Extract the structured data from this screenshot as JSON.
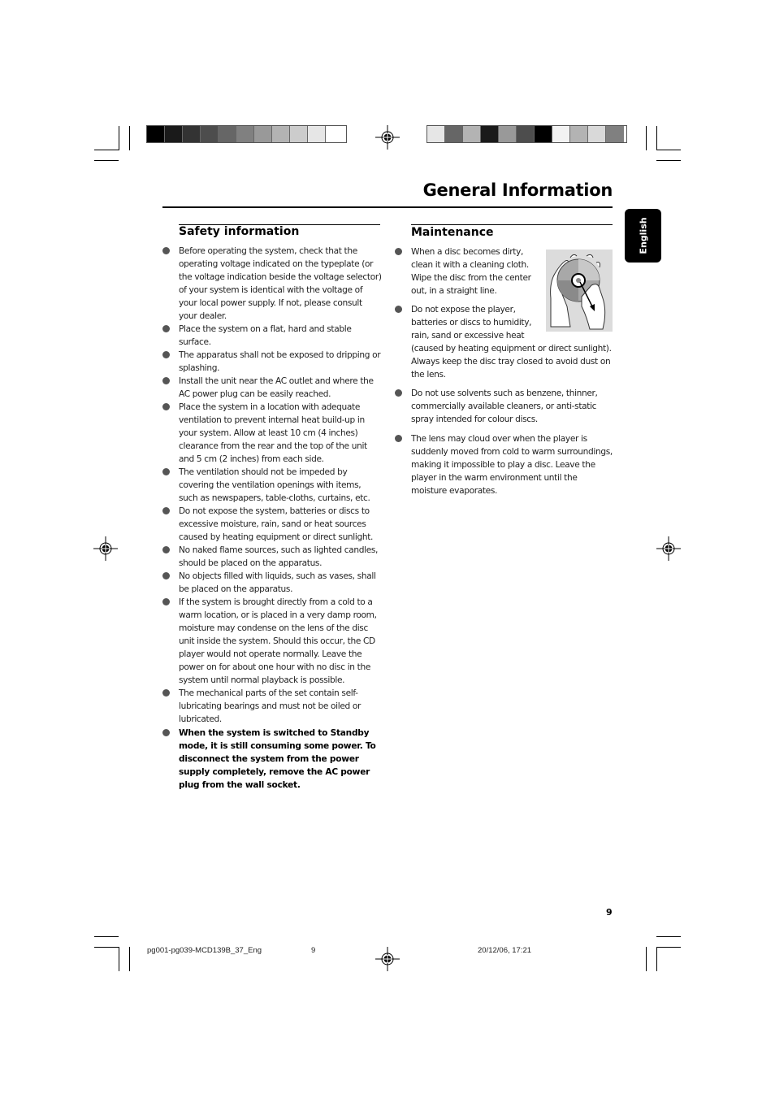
{
  "header": {
    "title": "General Information",
    "language_tab": "English"
  },
  "color_bars": {
    "left": [
      "#000000",
      "#1a1a1a",
      "#333333",
      "#4d4d4d",
      "#666666",
      "#808080",
      "#999999",
      "#b3b3b3",
      "#cccccc",
      "#e6e6e6",
      "#ffffff"
    ],
    "right": [
      "#e6e6e6",
      "#666666",
      "#b3b3b3",
      "#1a1a1a",
      "#999999",
      "#4d4d4d",
      "#000000",
      "#f2f2f2",
      "#b3b3b3",
      "#d9d9d9",
      "#808080"
    ]
  },
  "safety": {
    "heading": "Safety information",
    "items": [
      "Before operating the system, check that the operating voltage indicated on the typeplate (or the voltage indication beside the voltage selector) of your system is identical with the voltage of your local power supply. If not, please consult your dealer.",
      "Place the system on a flat, hard and stable surface.",
      "The apparatus shall not be exposed to dripping or splashing.",
      "Install the unit near the AC outlet and where the AC power plug can be easily reached.",
      "Place the system in a location with adequate ventilation to prevent internal heat build-up in your system.  Allow at least 10 cm (4 inches) clearance from the rear and the top of the unit and 5 cm (2 inches) from each side.",
      "The ventilation should not be impeded by covering the ventilation openings with items, such as newspapers, table-cloths, curtains, etc.",
      "Do not expose the system, batteries or discs to excessive moisture, rain, sand or heat sources caused by heating equipment or direct sunlight.",
      "No naked flame sources, such as lighted candles, should be placed on the apparatus.",
      "No objects filled with liquids, such as vases, shall be placed on the apparatus.",
      "If the system is brought directly from a cold to a warm location, or is placed in a very damp room, moisture may condense on the lens of the disc unit inside the system. Should this occur, the CD player would not operate normally. Leave the power on for about one hour with no disc in the system until normal playback is possible.",
      "The mechanical parts of the set contain self-lubricating bearings and must not be oiled or lubricated.",
      "When the system is switched to Standby mode, it is still consuming some power. To disconnect the system from the power supply completely, remove the AC power plug from the wall socket."
    ]
  },
  "maintenance": {
    "heading": "Maintenance",
    "items": [
      "When a disc becomes dirty, clean it with a cleaning cloth. Wipe the disc from the center out, in a straight line.",
      "Do not expose the player, batteries or discs to humidity, rain, sand or excessive heat (caused by heating equipment or direct sunlight). Always keep the disc tray closed to avoid dust on the lens.",
      "Do not use solvents such as benzene, thinner, commercially available cleaners, or anti-static spray intended for colour discs.",
      "The lens may cloud over when the player is suddenly moved from cold to warm surroundings, making it impossible to play a disc. Leave the player in the warm environment until the moisture evaporates."
    ],
    "illustration": "disc-cleaning-illustration"
  },
  "footer": {
    "page_number": "9",
    "file_name": "pg001-pg039-MCD139B_37_Eng",
    "sheet_number": "9",
    "timestamp": "20/12/06, 17:21"
  }
}
